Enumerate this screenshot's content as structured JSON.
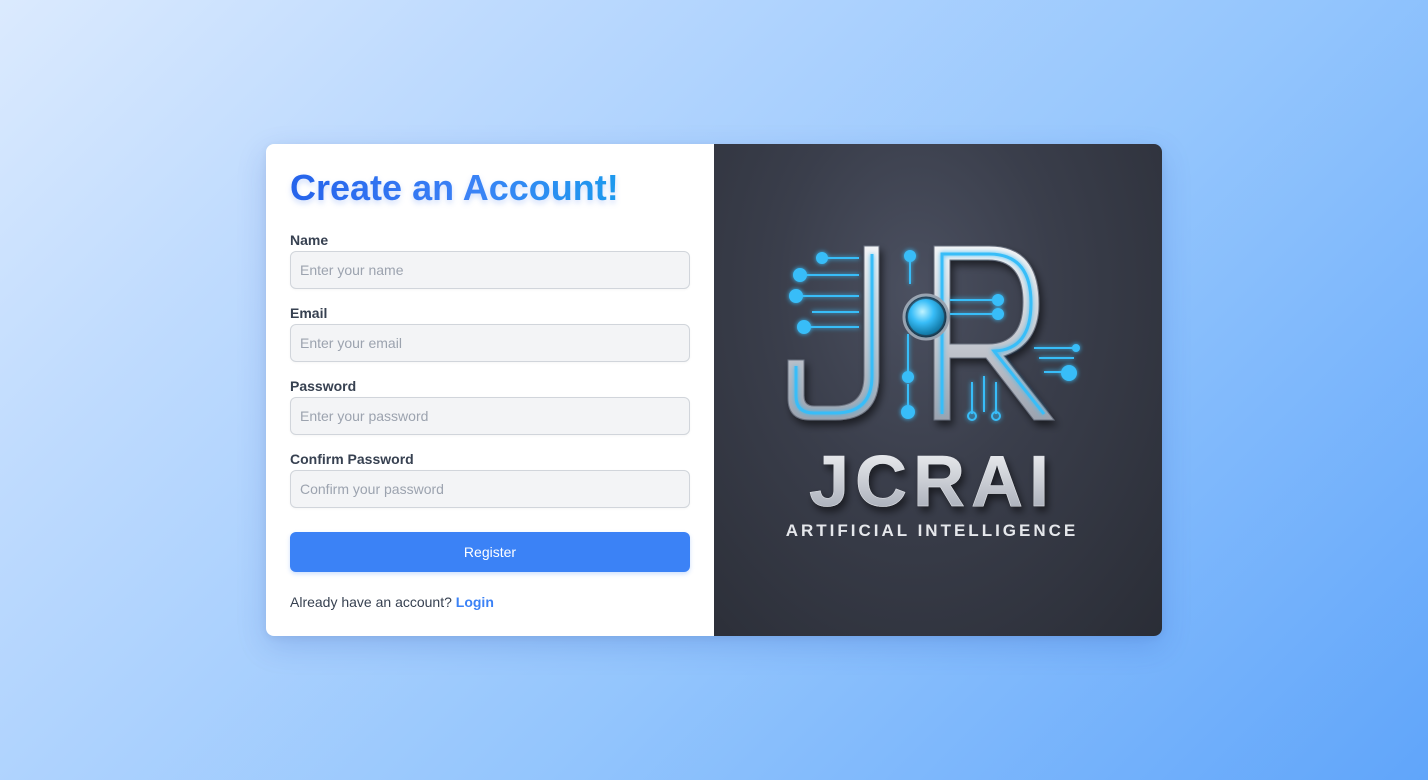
{
  "form": {
    "title": "Create an Account!",
    "fields": [
      {
        "label": "Name",
        "placeholder": "Enter your name",
        "type": "text"
      },
      {
        "label": "Email",
        "placeholder": "Enter your email",
        "type": "email"
      },
      {
        "label": "Password",
        "placeholder": "Enter your password",
        "type": "password"
      },
      {
        "label": "Confirm Password",
        "placeholder": "Confirm your password",
        "type": "password"
      }
    ],
    "register_label": "Register",
    "login_prompt": "Already have an account?",
    "login_link": "Login"
  },
  "brand": {
    "monogram": "JR",
    "name": "JCRAI",
    "tagline": "ARTIFICIAL INTELLIGENCE"
  },
  "colors": {
    "accent": "#3b82f6",
    "title_gradient_start": "#2563eb",
    "title_gradient_end": "#0ea5e9",
    "circuit_cyan": "#38bdf8",
    "panel_dark": "#2f323c"
  }
}
